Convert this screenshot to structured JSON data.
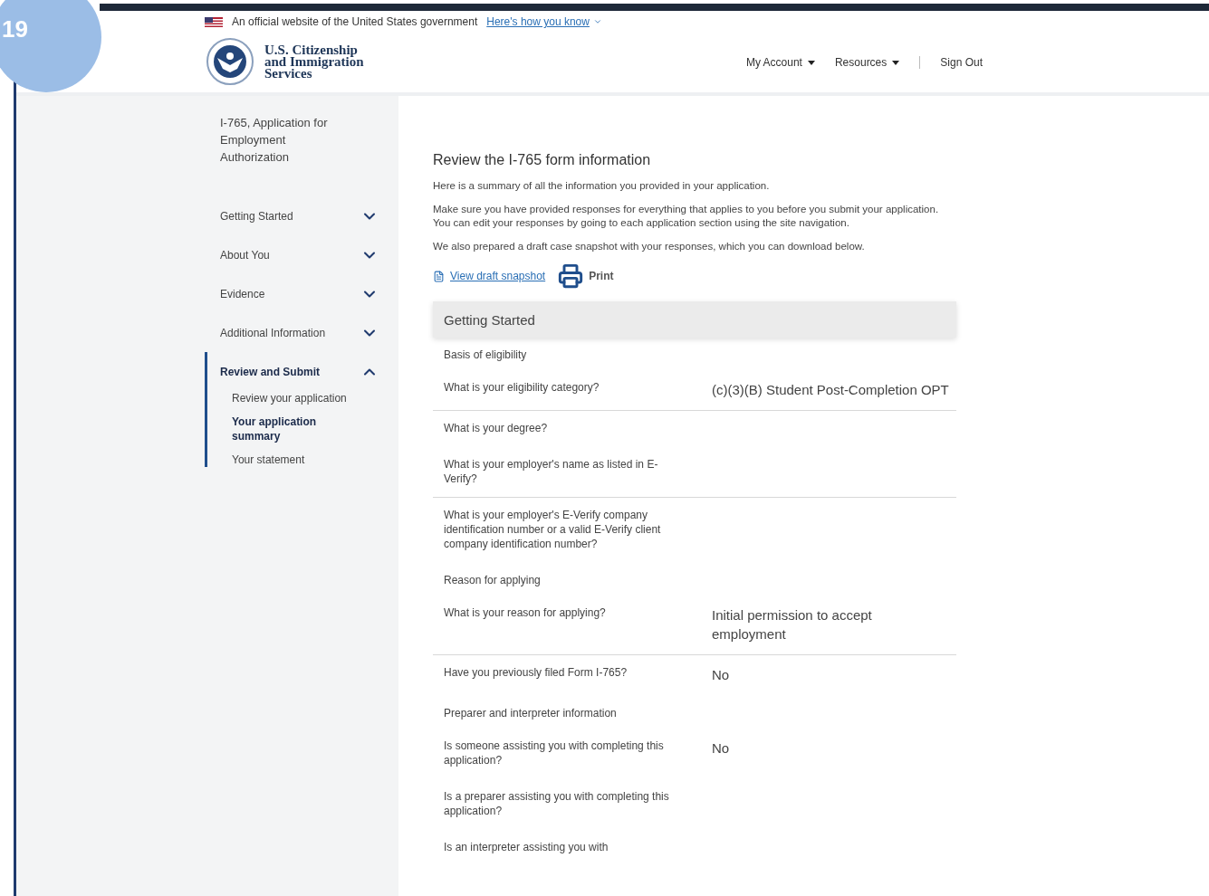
{
  "slide_badge": {
    "number": "19"
  },
  "banner": {
    "text": "An official website of the United States government",
    "link": "Here's how you know"
  },
  "agency": {
    "name_lines": [
      "U.S. Citizenship",
      "and Immigration",
      "Services"
    ]
  },
  "nav": [
    {
      "label": "My Account",
      "kind": "menu"
    },
    {
      "label": "Resources",
      "kind": "menu"
    },
    {
      "label": "Sign Out",
      "kind": "link"
    }
  ],
  "sidebar": {
    "title": "I-765, Application for Employment Authorization",
    "items": [
      {
        "label": "Getting Started",
        "expanded": false,
        "selected": false
      },
      {
        "label": "About You",
        "expanded": false,
        "selected": false
      },
      {
        "label": "Evidence",
        "expanded": false,
        "selected": false
      },
      {
        "label": "Additional Information",
        "expanded": false,
        "selected": false
      },
      {
        "label": "Review and Submit",
        "expanded": true,
        "selected": true,
        "children": [
          {
            "label": "Review your application",
            "selected": false
          },
          {
            "label": "Your application summary",
            "selected": true
          },
          {
            "label": "Your statement",
            "selected": false
          }
        ]
      }
    ]
  },
  "main": {
    "title": "Review the I-765 form information",
    "paragraphs": [
      "Here is a summary of all the information you provided in your application.",
      "Make sure you have provided responses for everything that applies to you before you submit your application. You can edit your responses by going to each application section using the site navigation.",
      "We also prepared a draft case snapshot with your responses, which you can download below."
    ],
    "snapshot_link": "View draft snapshot",
    "print": "Print",
    "rows": [
      {
        "kind": "section",
        "label": "Getting Started"
      },
      {
        "kind": "subheading",
        "label": "Basis of eligibility"
      },
      {
        "kind": "qa",
        "question": "What is your eligibility category?",
        "answer": "(c)(3)(B) Student Post-Completion OPT",
        "underlined": true
      },
      {
        "kind": "qa",
        "question": "What is your degree?",
        "underlined": false
      },
      {
        "kind": "qa",
        "question": "What is your employer's name as listed in E-Verify?",
        "underlined": true
      },
      {
        "kind": "qa",
        "question": "What is your employer's E-Verify company identification number or a valid E-Verify client company identification number?",
        "underlined": false
      },
      {
        "kind": "subheading",
        "label": "Reason for applying"
      },
      {
        "kind": "qa",
        "question": "What is your reason for applying?",
        "answer": "Initial permission to accept employment",
        "underlined": true
      },
      {
        "kind": "qa",
        "question": "Have you previously filed Form I-765?",
        "answer": "No",
        "underlined": false
      },
      {
        "kind": "subheading",
        "label": "Preparer and interpreter information"
      },
      {
        "kind": "qa",
        "question": "Is someone assisting you with completing this application?",
        "answer": "No",
        "underlined": false
      },
      {
        "kind": "qa",
        "question": "Is a preparer assisting you with completing this application?",
        "underlined": false
      },
      {
        "kind": "qa",
        "question": "Is an interpreter assisting you with",
        "underlined": false
      }
    ]
  }
}
